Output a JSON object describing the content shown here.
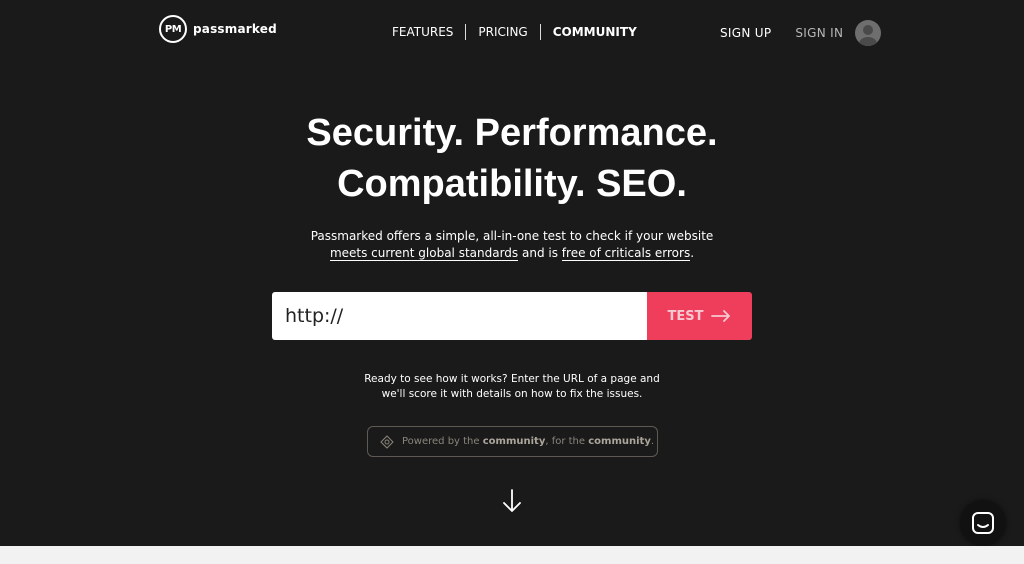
{
  "brand": {
    "logo_mark": "PM",
    "name": "passmarked"
  },
  "nav": {
    "items": [
      {
        "label": "FEATURES"
      },
      {
        "label": "PRICING"
      },
      {
        "label": "COMMUNITY",
        "active": true
      }
    ]
  },
  "auth": {
    "signup": "SIGN UP",
    "signin": "SIGN IN",
    "avatar_icon": "user-avatar-icon"
  },
  "hero": {
    "line1": "Security. Performance.",
    "line2": "Compatibility. SEO."
  },
  "subtitle": {
    "part1": "Passmarked offers a simple, all-in-one test to check if your website",
    "link1": "meets current global standards",
    "part2": " and is ",
    "link2": "free of criticals errors",
    "part3": "."
  },
  "search": {
    "value": "http://",
    "button_label": "TEST",
    "button_icon": "arrow-right-icon"
  },
  "hint": {
    "line1": "Ready to see how it works? Enter the URL of a page and",
    "line2": "we'll score it with details on how to fix the issues."
  },
  "community_pill": {
    "icon": "community-badge-icon",
    "pre": "Powered by the ",
    "bold1": "community",
    "mid": ", for the ",
    "bold2": "community",
    "post": "."
  },
  "scroll_icon": "arrow-down-icon",
  "chat_icon": "chat-bubble-icon",
  "colors": {
    "background": "#1b1a1a",
    "accent": "#ef3d5c",
    "text": "#ffffff"
  }
}
